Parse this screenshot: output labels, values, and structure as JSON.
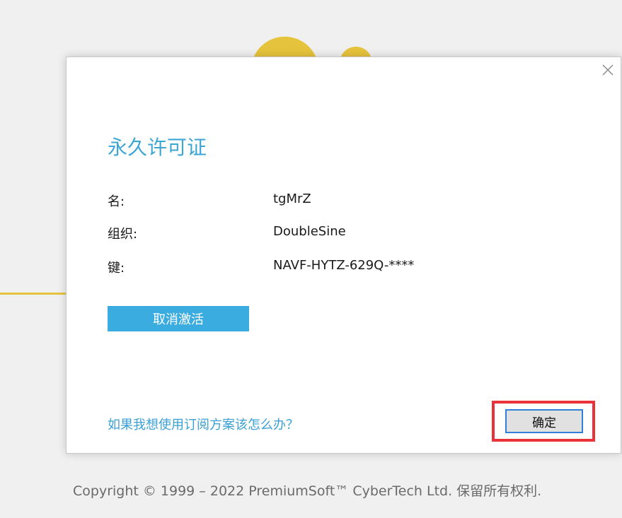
{
  "dialog": {
    "title": "永久许可证",
    "fields": [
      {
        "label": "名:",
        "value": "tgMrZ"
      },
      {
        "label": "组织:",
        "value": "DoubleSine"
      },
      {
        "label": "键:",
        "value": "NAVF-HYTZ-629Q-****"
      }
    ],
    "deactivate_label": "取消激活",
    "subscription_link": "如果我想使用订阅方案该怎么办？",
    "ok_label": "确定",
    "close_icon": "close-icon"
  },
  "footer": {
    "copyright": "Copyright © 1999 – 2022 PremiumSoft™ CyberTech Ltd. 保留所有权利."
  },
  "colors": {
    "accent": "#3aace0",
    "title": "#3ca6d6",
    "highlight": "#e8333a",
    "background_decoration": "#e6c33c"
  }
}
